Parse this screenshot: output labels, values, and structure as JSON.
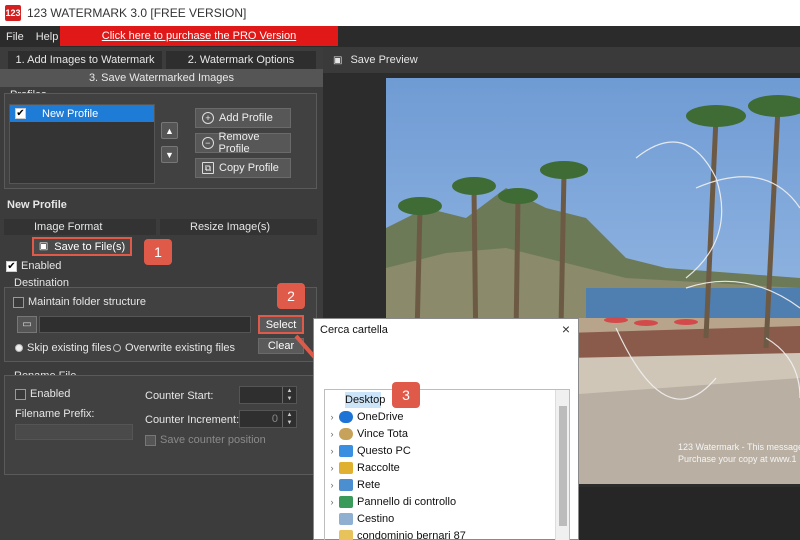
{
  "window": {
    "title": "123 WATERMARK 3.0 [FREE VERSION]",
    "icon_text": "123"
  },
  "menu": {
    "file": "File",
    "help": "Help",
    "promo": "Click here to purchase the PRO Version"
  },
  "tabs": {
    "tab1": "1. Add Images to Watermark",
    "tab2": "2. Watermark Options",
    "tab3": "3. Save Watermarked Images"
  },
  "profiles": {
    "label": "Profiles",
    "items": [
      {
        "label": "New Profile",
        "checked": true
      }
    ],
    "add": "Add Profile",
    "remove": "Remove Profile",
    "copy": "Copy Profile"
  },
  "profile_name": "New Profile",
  "subtabs": {
    "image_format": "Image Format",
    "resize": "Resize Image(s)",
    "save_to_file": "Save to File(s)"
  },
  "enabled_label": "Enabled",
  "destination": {
    "label": "Destination",
    "maintain": "Maintain folder structure",
    "select": "Select",
    "clear": "Clear",
    "skip": "Skip existing files",
    "overwrite": "Overwrite existing files"
  },
  "rename": {
    "label": "Rename File",
    "enabled": "Enabled",
    "prefix_label": "Filename Prefix:",
    "counter_start": "Counter Start:",
    "counter_increment": "Counter Increment:",
    "counter_increment_value": "0",
    "save_counter": "Save counter position"
  },
  "preview": {
    "header": "Save Preview",
    "watermark_text_1": "123 Watermark - This message",
    "watermark_text_2": "Purchase your copy at www.1"
  },
  "dialog": {
    "title": "Cerca cartella",
    "close": "×",
    "tree": [
      {
        "label": "Desktop",
        "icon": "desktop-icon",
        "color": "#2f7fd6",
        "expandable": false,
        "selected": true
      },
      {
        "label": "OneDrive",
        "icon": "cloud-icon",
        "color": "#1d74d6",
        "expandable": true
      },
      {
        "label": "Vince Tota",
        "icon": "user-icon",
        "color": "#c7a25a",
        "expandable": true
      },
      {
        "label": "Questo PC",
        "icon": "computer-icon",
        "color": "#3a8fe0",
        "expandable": true
      },
      {
        "label": "Raccolte",
        "icon": "library-icon",
        "color": "#e0b030",
        "expandable": true
      },
      {
        "label": "Rete",
        "icon": "network-icon",
        "color": "#4b8fd0",
        "expandable": true
      },
      {
        "label": "Pannello di controllo",
        "icon": "control-panel-icon",
        "color": "#3a9a5a",
        "expandable": true
      },
      {
        "label": "Cestino",
        "icon": "recycle-bin-icon",
        "color": "#8fb0d0",
        "expandable": false
      },
      {
        "label": "condominio bernari 87",
        "icon": "folder-icon",
        "color": "#e8c25a",
        "expandable": false
      }
    ]
  },
  "annotations": {
    "b1": "1",
    "b2": "2",
    "b3": "3"
  },
  "colors": {
    "accent": "#1e7bd6",
    "annotation": "#e05a4a",
    "promo": "#e11818"
  }
}
